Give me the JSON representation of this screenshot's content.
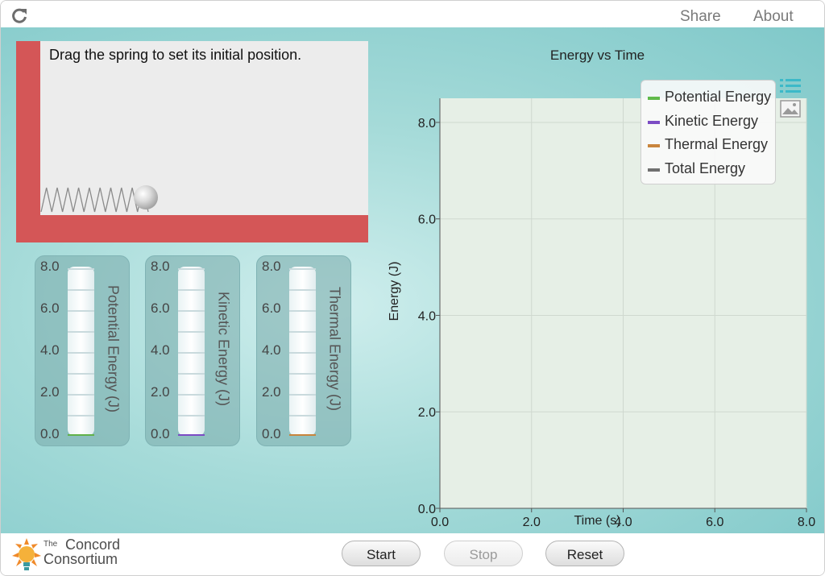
{
  "header": {
    "share_label": "Share",
    "about_label": "About",
    "reload_icon": "reload-icon"
  },
  "simulation": {
    "instruction": "Drag the spring to set its initial position."
  },
  "meters": [
    {
      "title": "Potential Energy (J)",
      "ticks": [
        "8.0",
        "6.0",
        "4.0",
        "2.0",
        "0.0"
      ],
      "value": 0.0,
      "fill_color": "#62b24a"
    },
    {
      "title": "Kinetic Energy (J)",
      "ticks": [
        "8.0",
        "6.0",
        "4.0",
        "2.0",
        "0.0"
      ],
      "value": 0.0,
      "fill_color": "#7c4cc4"
    },
    {
      "title": "Thermal Energy (J)",
      "ticks": [
        "8.0",
        "6.0",
        "4.0",
        "2.0",
        "0.0"
      ],
      "value": 0.0,
      "fill_color": "#c9853d"
    }
  ],
  "chart_data": {
    "type": "line",
    "title": "Energy vs Time",
    "xlabel": "Time (s)",
    "ylabel": "Energy (J)",
    "xlim": [
      0,
      8
    ],
    "ylim": [
      0,
      8.5
    ],
    "x_ticks": [
      "0.0",
      "2.0",
      "4.0",
      "6.0",
      "8.0"
    ],
    "y_ticks": [
      "0.0",
      "2.0",
      "4.0",
      "6.0",
      "8.0"
    ],
    "grid": true,
    "legend_position": "top-right",
    "series": [
      {
        "name": "Potential Energy",
        "color": "#5fba4a",
        "x": [],
        "y": []
      },
      {
        "name": "Kinetic Energy",
        "color": "#7c4cc4",
        "x": [],
        "y": []
      },
      {
        "name": "Thermal Energy",
        "color": "#c9853d",
        "x": [],
        "y": []
      },
      {
        "name": "Total Energy",
        "color": "#707070",
        "x": [],
        "y": []
      }
    ]
  },
  "footer": {
    "logo": {
      "the": "The",
      "line1": "Concord",
      "line2": "Consortium"
    },
    "start_label": "Start",
    "stop_label": "Stop",
    "reset_label": "Reset"
  }
}
